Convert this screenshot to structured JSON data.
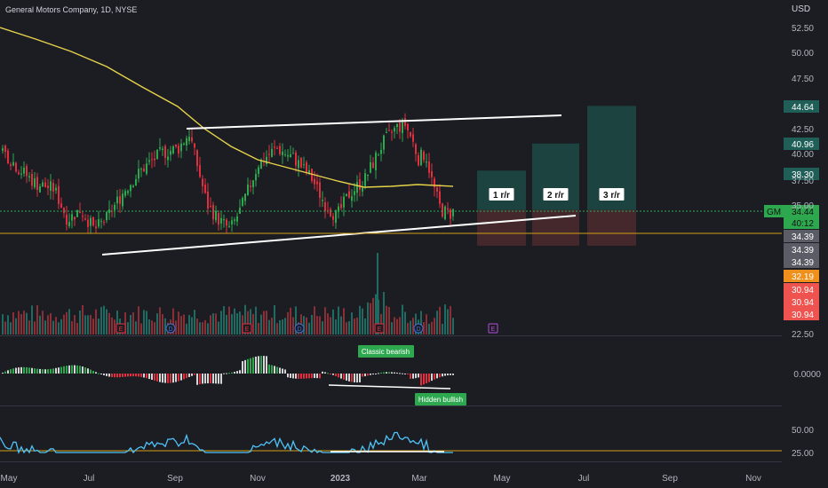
{
  "header": {
    "title": "General Motors Company, 1D, NYSE",
    "currency": "USD"
  },
  "colors": {
    "up": "#26a69a",
    "down": "#ef5350",
    "ma": "#e6d34a",
    "rsi": "#4fc3f7",
    "bg": "#1b1d23",
    "line": "#ffffff",
    "support": "#d4a017"
  },
  "chart_data": {
    "type": "candlestick",
    "price_axis_ticks": [
      52.5,
      50.0,
      47.5,
      42.5,
      40.0,
      37.5,
      35.0,
      22.5
    ],
    "price_tick_labels": [
      "52.50",
      "50.00",
      "47.50",
      "42.50",
      "40.00",
      "37.50",
      "35.00",
      "22.50"
    ],
    "x_tick_labels": [
      "May",
      "Jul",
      "Sep",
      "Nov",
      "2023",
      "Mar",
      "May",
      "Jul",
      "Sep",
      "Nov"
    ],
    "osc_tick_labels": [
      "0.0000"
    ],
    "rsi_tick_labels": [
      "50.00",
      "25.00"
    ],
    "symbol": "GM",
    "last_price": "34.44",
    "countdown": "40:12",
    "price_labels": [
      {
        "text": "44.64",
        "color": "#1f5f57"
      },
      {
        "text": "40.96",
        "color": "#1f5f57"
      },
      {
        "text": "38.30",
        "color": "#1f5f57"
      },
      {
        "text": "34.39",
        "color": "#5a5d66"
      },
      {
        "text": "34.39",
        "color": "#5a5d66"
      },
      {
        "text": "34.39",
        "color": "#5a5d66"
      },
      {
        "text": "32.19",
        "color": "#f0901c"
      },
      {
        "text": "30.94",
        "color": "#ef5350"
      },
      {
        "text": "30.94",
        "color": "#ef5350"
      },
      {
        "text": "30.94",
        "color": "#ef5350"
      }
    ],
    "rr_labels": [
      "1 r/r",
      "2 r/r",
      "3 r/r"
    ],
    "annotations": [
      "Classic bearish",
      "Hidden bullish"
    ],
    "event_markers": [
      "E",
      "D",
      "E",
      "D",
      "E",
      "D",
      "E"
    ]
  }
}
